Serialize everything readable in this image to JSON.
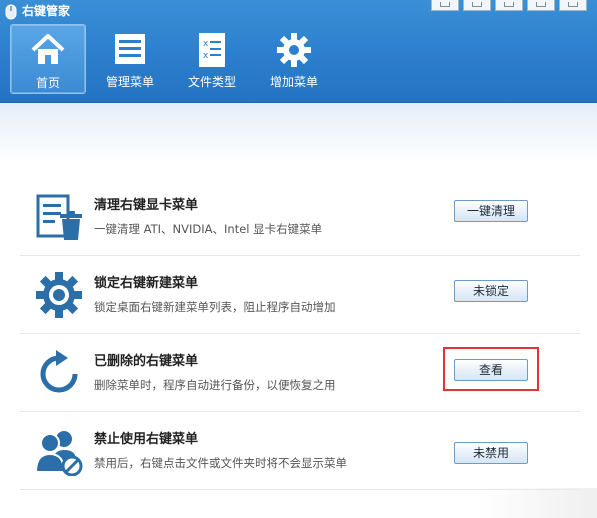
{
  "app": {
    "title": "右键管家"
  },
  "nav": [
    {
      "label": "首页",
      "icon": "home-icon",
      "active": true
    },
    {
      "label": "管理菜单",
      "icon": "menu-list-icon",
      "active": false
    },
    {
      "label": "文件类型",
      "icon": "file-type-icon",
      "active": false
    },
    {
      "label": "增加菜单",
      "icon": "gear-icon",
      "active": false
    }
  ],
  "rows": [
    {
      "title": "清理右键显卡菜单",
      "desc": "一键清理 ATI、NVIDIA、Intel 显卡右键菜单",
      "button": "一键清理",
      "icon": "clean-trash-icon"
    },
    {
      "title": "锁定右键新建菜单",
      "desc": "锁定桌面右键新建菜单列表，阻止程序自动增加",
      "button": "未锁定",
      "icon": "gear-lock-icon"
    },
    {
      "title": "已删除的右键菜单",
      "desc": "删除菜单时，程序自动进行备份，以便恢复之用",
      "button": "查看",
      "icon": "restore-arrow-icon"
    },
    {
      "title": "禁止使用右键菜单",
      "desc": "禁用后，右键点击文件或文件夹时将不会显示菜单",
      "button": "未禁用",
      "icon": "user-disable-icon"
    }
  ],
  "colors": {
    "header": "#2c7fcc",
    "icon_blue": "#2b6ea8",
    "highlight": "#e53232"
  }
}
